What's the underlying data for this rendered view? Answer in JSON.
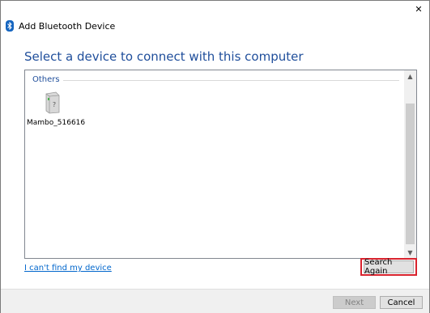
{
  "window": {
    "title": "Add Bluetooth Device",
    "close_glyph": "✕"
  },
  "main": {
    "heading": "Select a device to connect with this computer",
    "group_label": "Others",
    "devices": [
      {
        "name": "Mambo_516616",
        "icon": "unknown-device-icon"
      }
    ],
    "cant_find_link": "I can't find my device",
    "search_again_label": "Search Again"
  },
  "footer": {
    "next_label": "Next",
    "cancel_label": "Cancel"
  },
  "colors": {
    "heading": "#1f4e9b",
    "link": "#0066cc",
    "highlight": "#d9232e"
  }
}
